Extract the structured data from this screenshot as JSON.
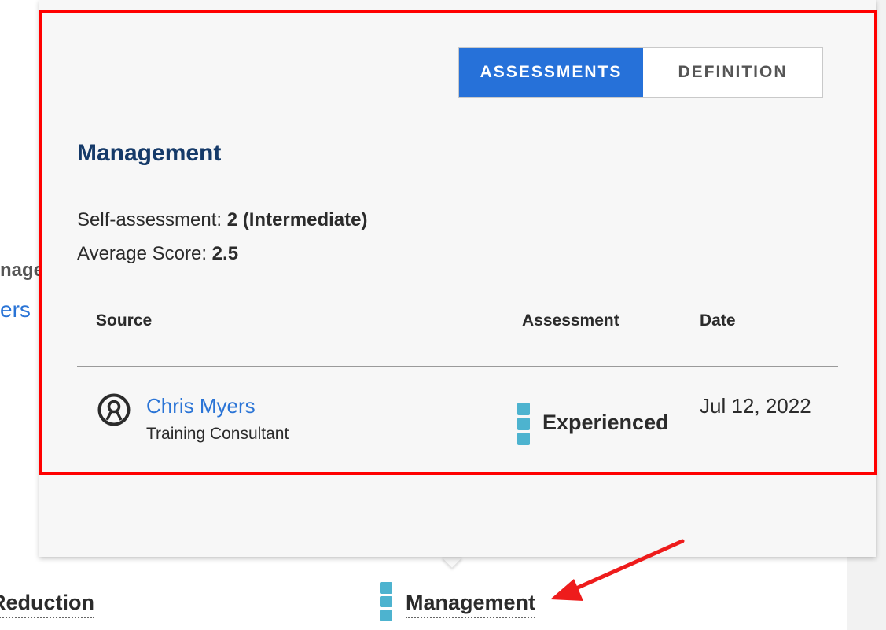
{
  "background": {
    "fragment_top": "nage",
    "fragment_link": "ers",
    "bottom_left_link": "Reduction",
    "bottom_center_link": "Management"
  },
  "popover": {
    "tabs": [
      {
        "label": "ASSESSMENTS",
        "active": true
      },
      {
        "label": "DEFINITION",
        "active": false
      }
    ],
    "title": "Management",
    "self_assessment_label": "Self-assessment:",
    "self_assessment_value": "2 (Intermediate)",
    "average_score_label": "Average Score:",
    "average_score_value": "2.5",
    "table": {
      "columns": [
        "Source",
        "Assessment",
        "Date"
      ],
      "rows": [
        {
          "name": "Chris Myers",
          "role": "Training Consultant",
          "assessment": "Experienced",
          "date": "Jul 12, 2022"
        }
      ]
    }
  },
  "colors": {
    "accent": "#2671d9",
    "title": "#153a69",
    "level_bar": "#4db3cf",
    "highlight": "#ff0000"
  },
  "icons": {
    "user": "person-circle-icon",
    "level": "skill-level-bar-icon"
  }
}
